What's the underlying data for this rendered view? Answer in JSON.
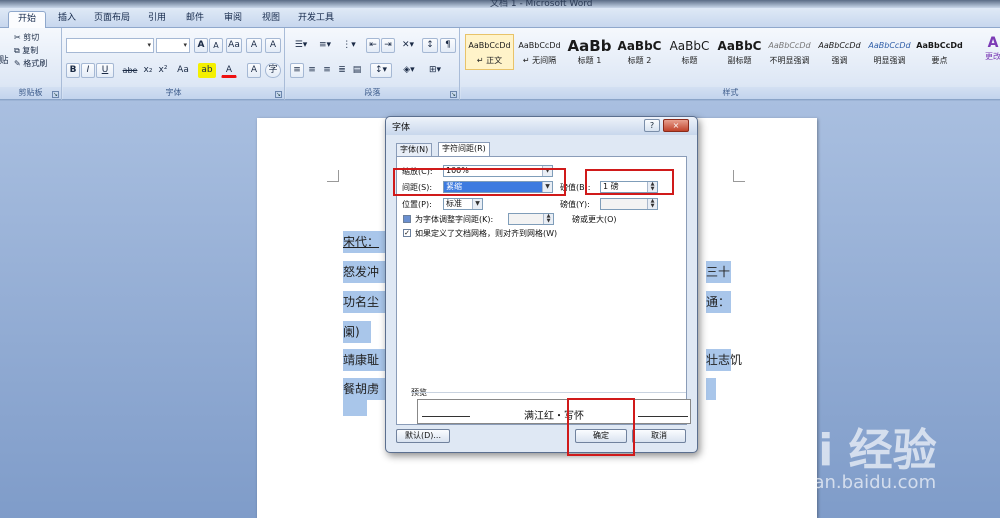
{
  "window": {
    "title": "文档 1 - Microsoft Word"
  },
  "tabs": [
    "开始",
    "插入",
    "页面布局",
    "引用",
    "邮件",
    "审阅",
    "视图",
    "开发工具"
  ],
  "clipboard": {
    "paste": "贴",
    "cut": "剪切",
    "copy": "复制",
    "format_painter": "格式刷",
    "label": "剪贴板"
  },
  "font_group": {
    "label": "字体",
    "buttons_row1": [
      "A",
      "A",
      "Aa",
      "A"
    ],
    "buttons_row2": [
      "B",
      "I",
      "U",
      "abe",
      "x₂",
      "x²",
      "Aa",
      "ab",
      "A",
      "A",
      "字"
    ]
  },
  "paragraph_group": {
    "label": "段落"
  },
  "styles_group": {
    "label": "样式",
    "items": [
      {
        "sample": "AaBbCcDd",
        "name": "↵ 正文"
      },
      {
        "sample": "AaBbCcDd",
        "name": "↵ 无间隔"
      },
      {
        "sample": "AaBb",
        "name": "标题 1"
      },
      {
        "sample": "AaBbC",
        "name": "标题 2"
      },
      {
        "sample": "AaBbC",
        "name": "标题"
      },
      {
        "sample": "AaBbC",
        "name": "副标题"
      },
      {
        "sample": "AaBbCcDd",
        "name": "不明显强调"
      },
      {
        "sample": "AaBbCcDd",
        "name": "强调"
      },
      {
        "sample": "AaBbCcDd",
        "name": "明显强调"
      },
      {
        "sample": "AaBbCcDd",
        "name": "要点"
      }
    ],
    "change_styles": "更改"
  },
  "document": {
    "lines": [
      "宋代：",
      "怒发冲",
      "功名尘",
      "阑)",
      "靖康耻",
      "餐胡虏"
    ],
    "right_fragments": [
      "三十",
      "通：",
      "壮志饥"
    ]
  },
  "dialog": {
    "title": "字体",
    "help": "?",
    "close": "×",
    "tabs": [
      "字体(N)",
      "字符间距(R)"
    ],
    "scale_label": "缩放(C):",
    "scale_value": "100%",
    "spacing_label": "间距(S):",
    "spacing_value": "紧缩",
    "spacing_by_label": "磅值(B):",
    "spacing_by_value": "1 磅",
    "position_label": "位置(P):",
    "position_value": "标准",
    "position_by_label": "磅值(Y):",
    "kerning_label": "为字体调整字间距(K):",
    "kerning_suffix": "磅或更大(O)",
    "snap_label": "如果定义了文档网格，则对齐到网格(W)",
    "snap_mark": "✓",
    "preview_label": "预览",
    "preview_text": "满江红・写怀",
    "default_button": "默认(D)...",
    "ok_button": "确定",
    "cancel_button": "取消"
  },
  "watermark": {
    "logo": "Bai 经验",
    "url": "jingyan.baidu.com"
  },
  "colors": {
    "annotation": "#d01a1a",
    "selection": "#a9c6ea",
    "ribbon": "#dde7f5"
  }
}
